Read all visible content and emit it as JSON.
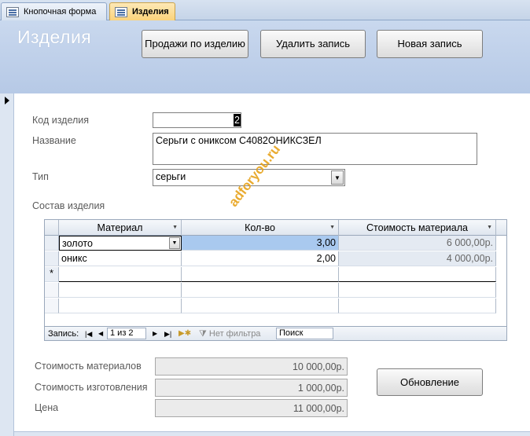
{
  "tabs": [
    {
      "label": "Кнопочная форма",
      "active": false
    },
    {
      "label": "Изделия",
      "active": true
    }
  ],
  "header": {
    "title": "Изделия",
    "buttons": {
      "sales": "Продажи по изделию",
      "delete": "Удалить запись",
      "new": "Новая запись"
    }
  },
  "fields": {
    "code": {
      "label": "Код изделия",
      "value": "2"
    },
    "name": {
      "label": "Название",
      "value": "Серьги с ониксом С4082ОНИКСЗЕЛ"
    },
    "type": {
      "label": "Тип",
      "value": "серьги"
    }
  },
  "subform": {
    "label": "Состав изделия",
    "columns": [
      "Материал",
      "Кол-во",
      "Стоимость материала"
    ],
    "rows": [
      {
        "material": "золото",
        "qty": "3,00",
        "cost": "6 000,00р."
      },
      {
        "material": "оникс",
        "qty": "2,00",
        "cost": "4 000,00р."
      }
    ],
    "new_row_marker": "*",
    "navigator": {
      "record_label": "Запись:",
      "position": "1 из 2",
      "filter": "Нет фильтра",
      "search": "Поиск"
    }
  },
  "totals": {
    "materials": {
      "label": "Стоимость материалов",
      "value": "10 000,00р."
    },
    "production": {
      "label": "Стоимость изготовления",
      "value": "1 000,00р."
    },
    "price": {
      "label": "Цена",
      "value": "11 000,00р."
    }
  },
  "refresh_button": "Обновление",
  "watermark": "adforyou.ru",
  "colors": {
    "header": "#c4d4ec",
    "active_tab": "#fbd37a",
    "qty_highlight": "#a9c9ef"
  }
}
